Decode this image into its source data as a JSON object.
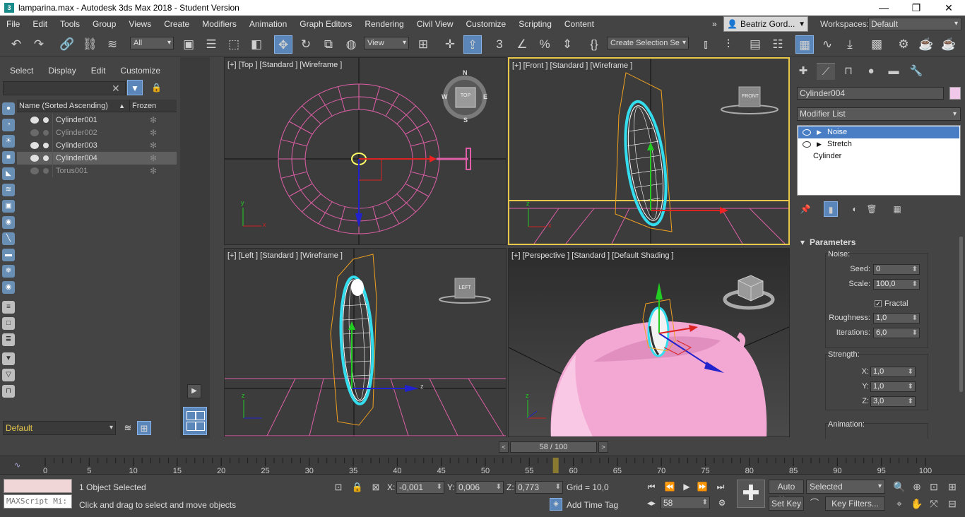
{
  "window": {
    "title": "lamparina.max - Autodesk 3ds Max 2018 - Student Version",
    "app_icon": "3"
  },
  "menu": {
    "items": [
      "File",
      "Edit",
      "Tools",
      "Group",
      "Views",
      "Create",
      "Modifiers",
      "Animation",
      "Graph Editors",
      "Rendering",
      "Civil View",
      "Customize",
      "Scripting",
      "Content"
    ],
    "overflow": "»",
    "user": "Beatriz Gord...",
    "workspaces_label": "Workspaces:",
    "workspace": "Default"
  },
  "toolbar": {
    "selection_filter": "All",
    "ref_coord": "View",
    "selection_set": "Create Selection Se"
  },
  "explorer": {
    "tabs": [
      "Select",
      "Display",
      "Edit",
      "Customize"
    ],
    "col_name": "Name (Sorted Ascending)",
    "col_frozen": "Frozen",
    "sort_arrow": "▲",
    "objects": [
      {
        "name": "Cylinder001",
        "visible": true
      },
      {
        "name": "Cylinder002",
        "visible": false
      },
      {
        "name": "Cylinder003",
        "visible": true
      },
      {
        "name": "Cylinder004",
        "visible": true,
        "selected": true
      },
      {
        "name": "Torus001",
        "visible": false
      }
    ],
    "layer": "Default"
  },
  "viewports": {
    "top": {
      "label": "[+] [Top ] [Standard ] [Wireframe ]",
      "cube": "TOP"
    },
    "front": {
      "label": "[+] [Front ] [Standard ] [Wireframe ]",
      "cube": "FRONT"
    },
    "left": {
      "label": "[+] [Left ] [Standard ] [Wireframe ]",
      "cube": "LEFT"
    },
    "perspective": {
      "label": "[+] [Perspective ] [Standard ] [Default Shading ]"
    },
    "compass": {
      "n": "N",
      "s": "S",
      "e": "E",
      "w": "W"
    },
    "axis": {
      "x": "x",
      "y": "y",
      "z": "z"
    }
  },
  "command_panel": {
    "object_name": "Cylinder004",
    "object_color": "#f2c8ea",
    "modifier_list": "Modifier List",
    "stack": [
      "Noise",
      "Stretch",
      "Cylinder"
    ],
    "parameters": {
      "title": "Parameters",
      "noise_label": "Noise:",
      "seed_label": "Seed:",
      "seed": "0",
      "scale_label": "Scale:",
      "scale": "100,0",
      "fractal_label": "Fractal",
      "fractal": true,
      "roughness_label": "Roughness:",
      "roughness": "1,0",
      "iterations_label": "Iterations:",
      "iterations": "6,0",
      "strength_label": "Strength:",
      "x_label": "X:",
      "x": "1,0",
      "y_label": "Y:",
      "y": "1,0",
      "z_label": "Z:",
      "z": "3,0",
      "animation_label": "Animation:"
    }
  },
  "timeline": {
    "frame": "58 / 100",
    "current": 58,
    "end": 100,
    "ticks": [
      "0",
      "5",
      "10",
      "15",
      "20",
      "25",
      "30",
      "35",
      "40",
      "45",
      "50",
      "55",
      "60",
      "65",
      "70",
      "75",
      "80",
      "85",
      "90",
      "95",
      "100"
    ]
  },
  "status": {
    "maxscript": "MAXScript Mi:",
    "selected": "1 Object Selected",
    "prompt": "Click and drag to select and move objects",
    "x_label": "X:",
    "x": "-0,001",
    "y_label": "Y:",
    "y": "0,006",
    "z_label": "Z:",
    "z": "0,773",
    "grid": "Grid = 10,0",
    "add_time_tag": "Add Time Tag",
    "current_frame": "58",
    "auto_key": "Auto Key",
    "set_key": "Set Key",
    "key_mode": "Selected",
    "key_filters": "Key Filters..."
  }
}
